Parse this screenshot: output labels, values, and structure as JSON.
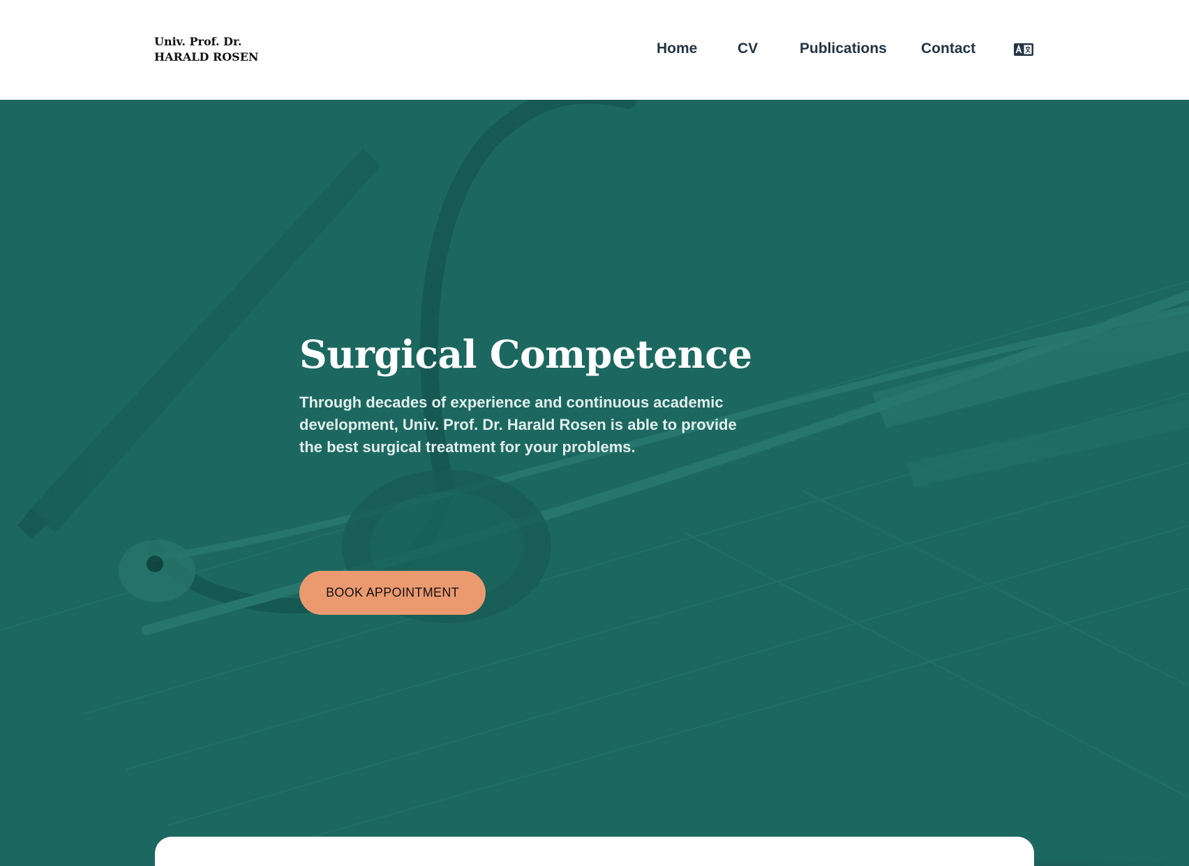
{
  "header": {
    "brand_line1": "Univ. Prof. Dr.",
    "brand_line2": "HARALD ROSEN",
    "nav": {
      "home": "Home",
      "cv": "CV",
      "publications": "Publications",
      "contact": "Contact"
    },
    "language_icon": "language-translate-icon"
  },
  "hero": {
    "title": "Surgical Competence",
    "text": "Through decades of experience and continuous academic development, Univ. Prof. Dr. Harald Rosen is able to provide the best surgical treatment for your problems.",
    "cta_label": "BOOK APPOINTMENT",
    "background_image": "stethoscope-on-medical-chart"
  },
  "colors": {
    "accent": "#eb9a70",
    "hero_overlay": "#1e6c64",
    "nav_text": "#243444"
  }
}
